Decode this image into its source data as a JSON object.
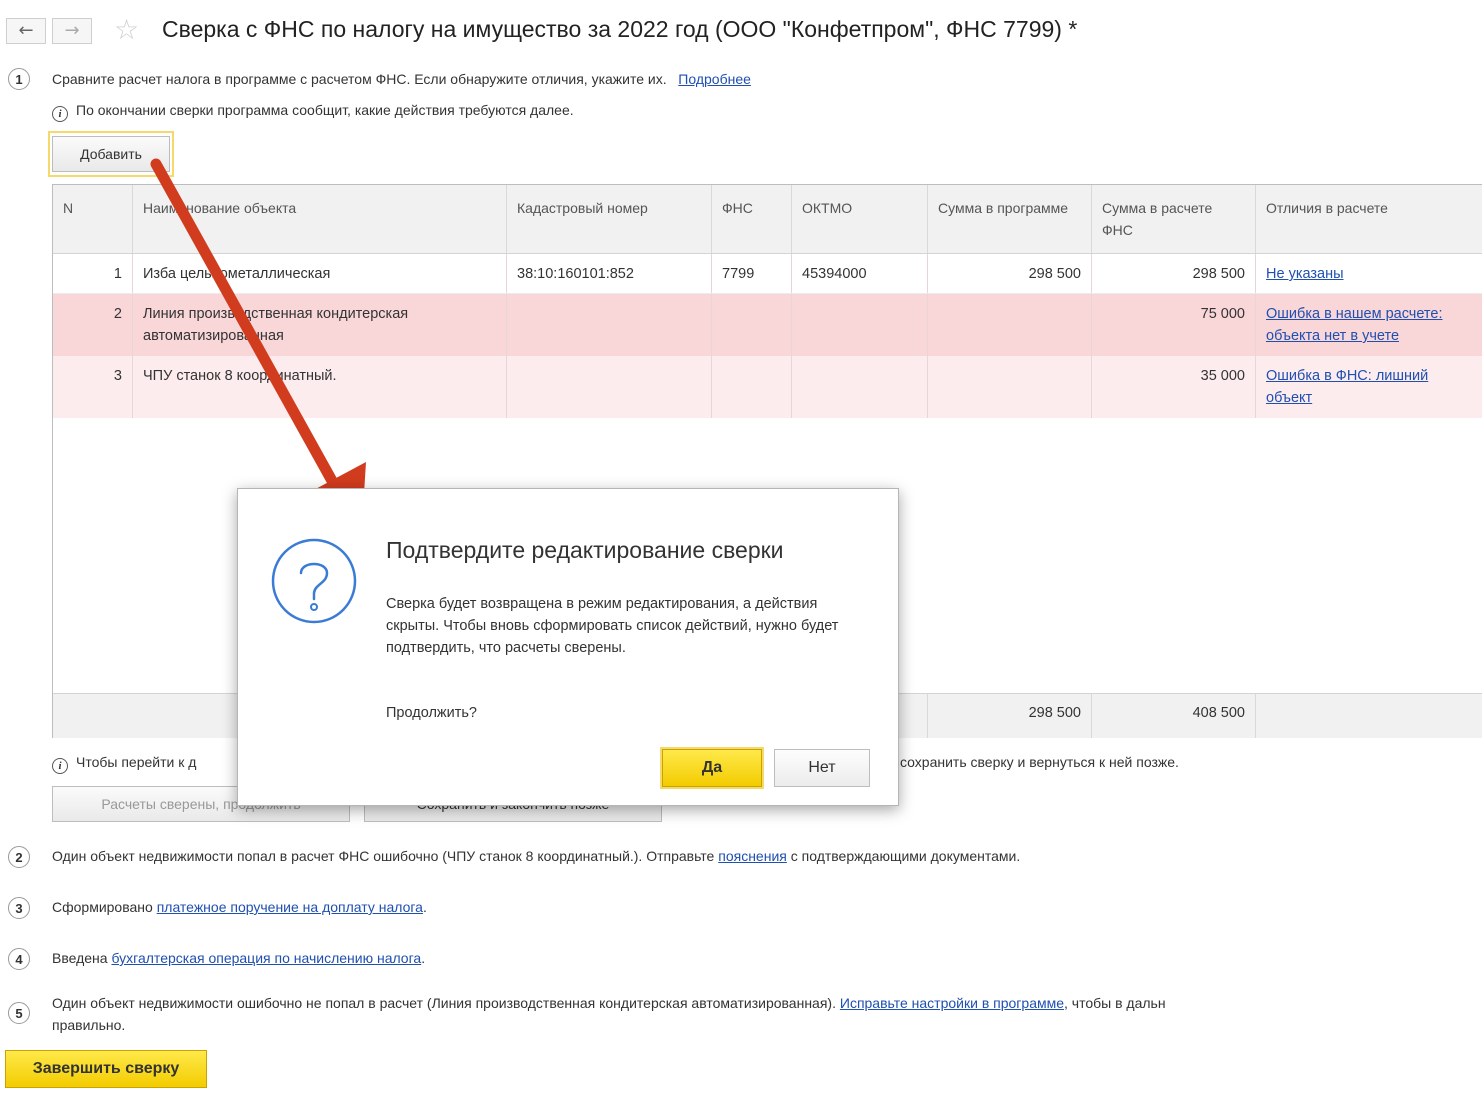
{
  "header": {
    "back": "←",
    "forward": "→",
    "star": "☆",
    "title": "Сверка с ФНС по налогу на имущество за 2022 год (ООО \"Конфетпром\", ФНС 7799) *"
  },
  "step1": {
    "num": "1",
    "text": "Сравните расчет налога в программе с расчетом ФНС. Если обнаружите отличия, укажите их.",
    "link": "Подробнее",
    "info": "По окончании сверки программа сообщит, какие действия требуются далее.",
    "add_button": "Добавить"
  },
  "table": {
    "columns": [
      "N",
      "Наименование объекта",
      "Кадастровый номер",
      "ФНС",
      "ОКТМО",
      "Сумма в программе",
      "Сумма в расчете ФНС",
      "Отличия в расчете"
    ],
    "rows": [
      {
        "n": "1",
        "name": "Изба цельнометаллическая",
        "cadastral": "38:10:160101:852",
        "fns": "7799",
        "oktmo": "45394000",
        "sum_program": "298 500",
        "sum_fns": "298 500",
        "diff": "Не указаны"
      },
      {
        "n": "2",
        "name": "Линия производственная кондитерская автоматизированная",
        "cadastral": "",
        "fns": "",
        "oktmo": "",
        "sum_program": "",
        "sum_fns": "75 000",
        "diff": "Ошибка в нашем расчете: объекта нет в учете"
      },
      {
        "n": "3",
        "name": "ЧПУ станок 8 координатный.",
        "cadastral": "",
        "fns": "",
        "oktmo": "",
        "sum_program": "",
        "sum_fns": "35 000",
        "diff": "Ошибка в ФНС: лишний объект"
      }
    ],
    "totals": {
      "sum_program": "298 500",
      "sum_fns": "408 500"
    }
  },
  "after_table": {
    "info_start": "Чтобы перейти к д",
    "info_end": "сохранить сверку и вернуться к ней позже.",
    "btn_confirm": "Расчеты сверены, продолжить",
    "btn_save": "Сохранить и закончить позже"
  },
  "step2": {
    "num": "2",
    "text_before": "Один объект недвижимости попал в расчет ФНС ошибочно (ЧПУ станок 8 координатный.). Отправьте",
    "link": "пояснения",
    "text_after": "с подтверждающими документами."
  },
  "step3": {
    "num": "3",
    "text_before": "Сформировано",
    "link": "платежное поручение на доплату налога",
    "text_after": "."
  },
  "step4": {
    "num": "4",
    "text_before": "Введена",
    "link": "бухгалтерская операция по начислению налога",
    "text_after": "."
  },
  "step5": {
    "num": "5",
    "text_before": "Один объект недвижимости ошибочно не попал в расчет (Линия производственная кондитерская автоматизированная).",
    "link": "Исправьте настройки в программе",
    "text_after": ", чтобы в дальн",
    "line2": "правильно."
  },
  "finish_button": "Завершить сверку",
  "dialog": {
    "title": "Подтвердите редактирование сверки",
    "body": "Сверка будет возвращена в режим редактирования, а действия скрыты. Чтобы вновь сформировать список действий, нужно будет подтвердить, что расчеты сверены.",
    "question": "Продолжить?",
    "yes": "Да",
    "no": "Нет"
  },
  "colors": {
    "accent_yellow": "#f3cc00",
    "row_pink": "#f9d7d9",
    "link": "#1f4fb0",
    "arrow": "#d23c1e"
  }
}
